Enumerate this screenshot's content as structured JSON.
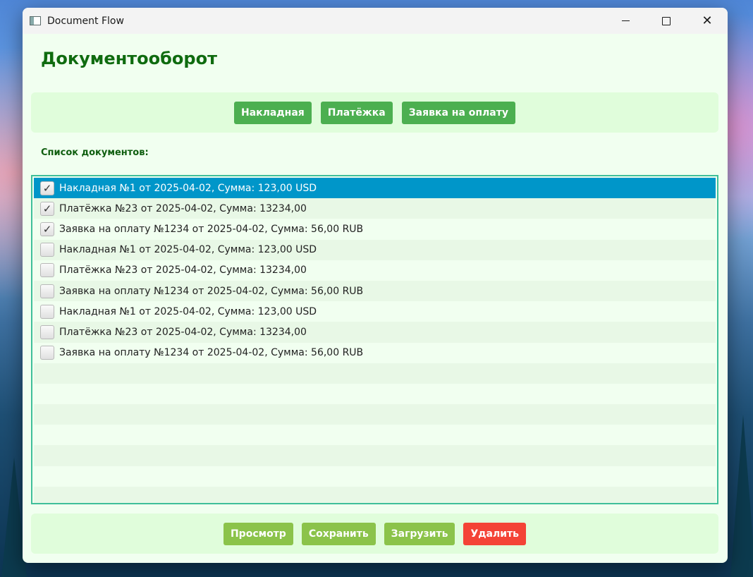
{
  "window": {
    "title": "Document Flow"
  },
  "page": {
    "title": "Документооборот",
    "list_label": "Список документов:"
  },
  "create_buttons": [
    "Накладная",
    "Платёжка",
    "Заявка на оплату"
  ],
  "documents": [
    {
      "text": "Накладная №1 от 2025-04-02, Сумма: 123,00 USD",
      "checked": true,
      "selected": true
    },
    {
      "text": "Платёжка №23 от 2025-04-02, Сумма: 13234,00",
      "checked": true,
      "selected": false
    },
    {
      "text": "Заявка на оплату №1234 от 2025-04-02, Сумма: 56,00 RUB",
      "checked": true,
      "selected": false
    },
    {
      "text": "Накладная №1 от 2025-04-02, Сумма: 123,00 USD",
      "checked": false,
      "selected": false
    },
    {
      "text": "Платёжка №23 от 2025-04-02, Сумма: 13234,00",
      "checked": false,
      "selected": false
    },
    {
      "text": "Заявка на оплату №1234 от 2025-04-02, Сумма: 56,00 RUB",
      "checked": false,
      "selected": false
    },
    {
      "text": "Накладная №1 от 2025-04-02, Сумма: 123,00 USD",
      "checked": false,
      "selected": false
    },
    {
      "text": "Платёжка №23 от 2025-04-02, Сумма: 13234,00",
      "checked": false,
      "selected": false
    },
    {
      "text": "Заявка на оплату №1234 от 2025-04-02, Сумма: 56,00 RUB",
      "checked": false,
      "selected": false
    }
  ],
  "action_buttons": {
    "view": "Просмотр",
    "save": "Сохранить",
    "load": "Загрузить",
    "delete": "Удалить"
  },
  "colors": {
    "title_green": "#0f6b0f",
    "button_green": "#4caf50",
    "button_lime": "#8bc34a",
    "button_red": "#f44336",
    "selection_blue": "#0096c9"
  }
}
